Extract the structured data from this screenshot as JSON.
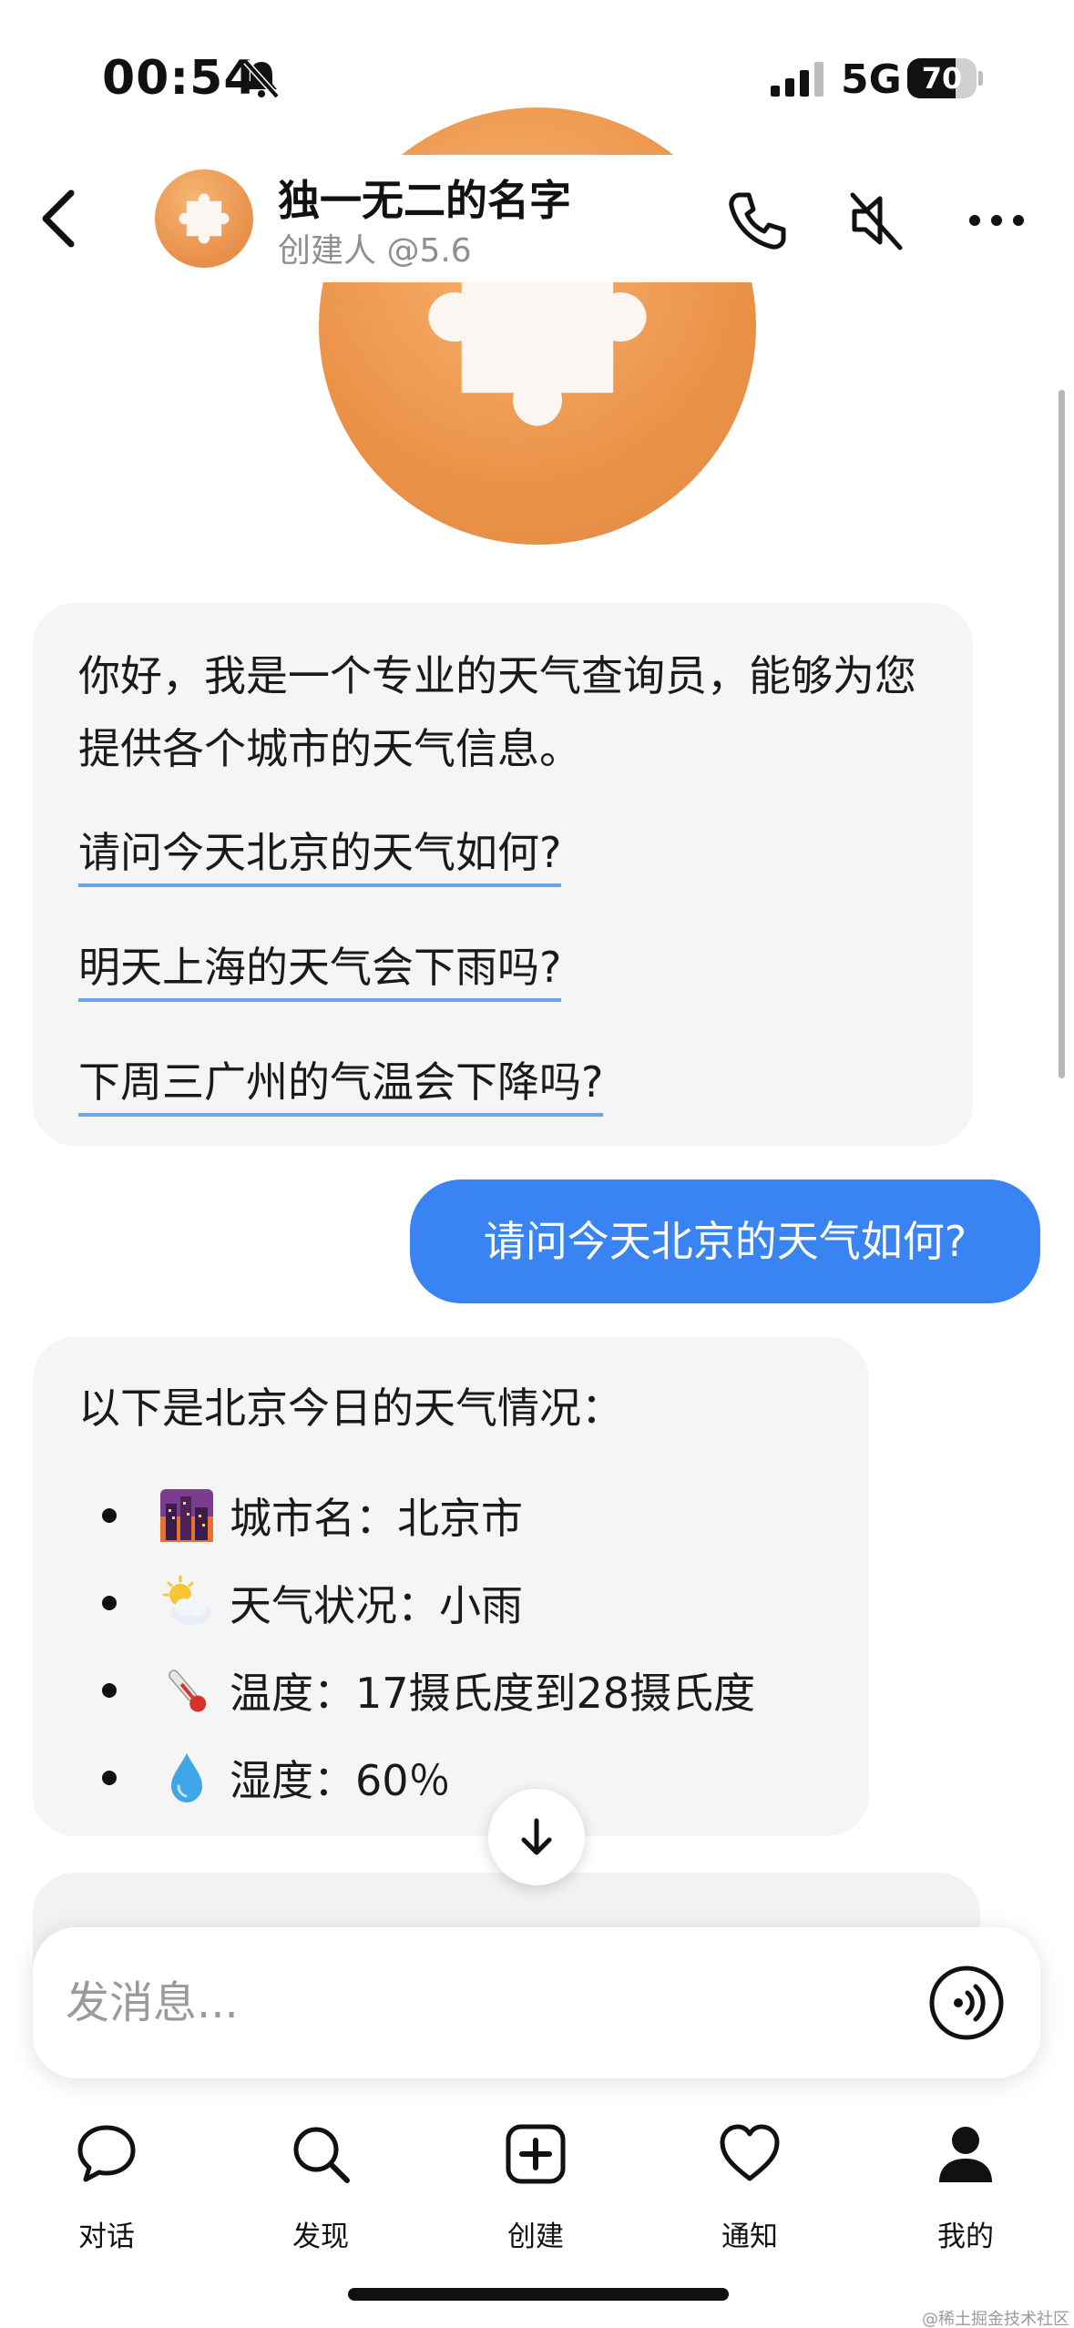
{
  "status_bar": {
    "time": "00:54",
    "network": "5G",
    "battery": "70",
    "battery_level": 0.7
  },
  "header": {
    "title": "独一无二的名字",
    "subtitle": "创建人 @5.6"
  },
  "welcome": {
    "text": "你好，我是一个专业的天气查询员，能够为您提供各个城市的天气信息。",
    "suggestions": [
      "请问今天北京的天气如何?",
      "明天上海的天气会下雨吗?",
      "下周三广州的气温会下降吗?"
    ]
  },
  "user_message": "请问今天北京的天气如何?",
  "answer": {
    "intro": "以下是北京今日的天气情况：",
    "items": [
      {
        "icon": "cityscape-icon",
        "text": "城市名：北京市"
      },
      {
        "icon": "sun-cloud-icon",
        "text": "天气状况：小雨"
      },
      {
        "icon": "thermometer-icon",
        "text": "温度：17摄氏度到28摄氏度"
      },
      {
        "icon": "droplet-icon",
        "text": "湿度：60％"
      }
    ]
  },
  "input": {
    "placeholder": "发消息..."
  },
  "tabs": [
    {
      "label": "对话",
      "icon": "chat-bubble-icon"
    },
    {
      "label": "发现",
      "icon": "search-icon"
    },
    {
      "label": "创建",
      "icon": "plus-square-icon"
    },
    {
      "label": "通知",
      "icon": "heart-icon"
    },
    {
      "label": "我的",
      "icon": "person-icon"
    }
  ],
  "watermark": "@稀土掘金技术社区"
}
